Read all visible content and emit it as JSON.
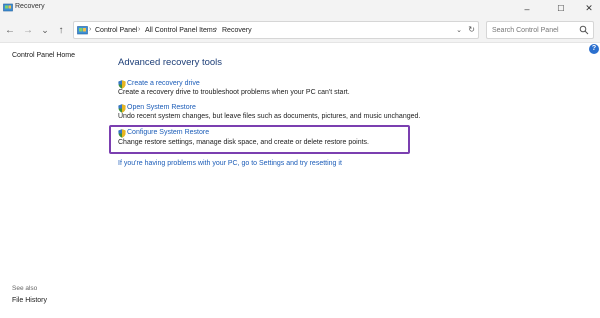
{
  "window": {
    "title": "Recovery",
    "minimize": "–",
    "maximize": "☐",
    "close": "✕"
  },
  "nav": {
    "back": "←",
    "forward": "→",
    "recent": "⌄",
    "up": "↑"
  },
  "address": {
    "crumbs": [
      "Control Panel",
      "All Control Panel Items",
      "Recovery"
    ],
    "separator": "›",
    "dropdown": "⌄",
    "refresh": "↻"
  },
  "search": {
    "placeholder": "Search Control Panel"
  },
  "help": "?",
  "sidebar": {
    "home_link": "Control Panel Home",
    "see_also_label": "See also",
    "file_history": "File History"
  },
  "main": {
    "heading": "Advanced recovery tools",
    "items": [
      {
        "label": "Create a recovery drive",
        "description": "Create a recovery drive to troubleshoot problems when your PC can't start."
      },
      {
        "label": "Open System Restore",
        "description": "Undo recent system changes, but leave files such as documents, pictures, and music unchanged."
      },
      {
        "label": "Configure System Restore",
        "description": "Change restore settings, manage disk space, and create or delete restore points."
      }
    ],
    "reset_link": "If you're having problems with your PC, go to Settings and try resetting it"
  },
  "colors": {
    "highlight": "#7b3fb0",
    "link": "#1b5cb8",
    "heading": "#1e3f78"
  }
}
